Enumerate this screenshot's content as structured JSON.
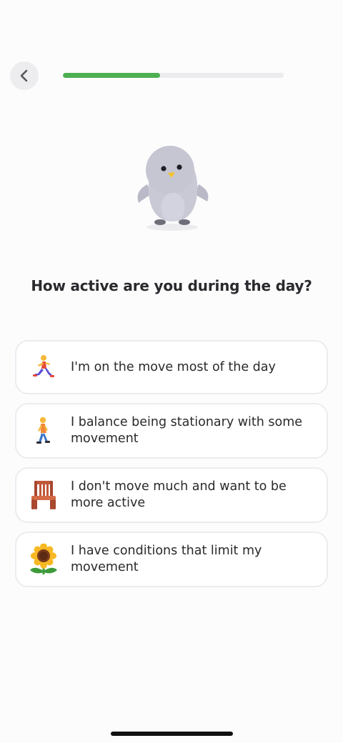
{
  "progress": {
    "fraction": 0.44
  },
  "question": "How active are you during the day?",
  "options": [
    {
      "label": "I'm on the move most of the day",
      "icon": "running-person-icon"
    },
    {
      "label": "I balance being stationary with some movement",
      "icon": "walking-person-icon"
    },
    {
      "label": "I don't move much and want to be more active",
      "icon": "chair-icon"
    },
    {
      "label": "I have conditions that limit my movement",
      "icon": "sunflower-icon"
    }
  ],
  "colors": {
    "accent": "#4caf50",
    "track": "#ececef",
    "card_border": "#ececf0"
  }
}
